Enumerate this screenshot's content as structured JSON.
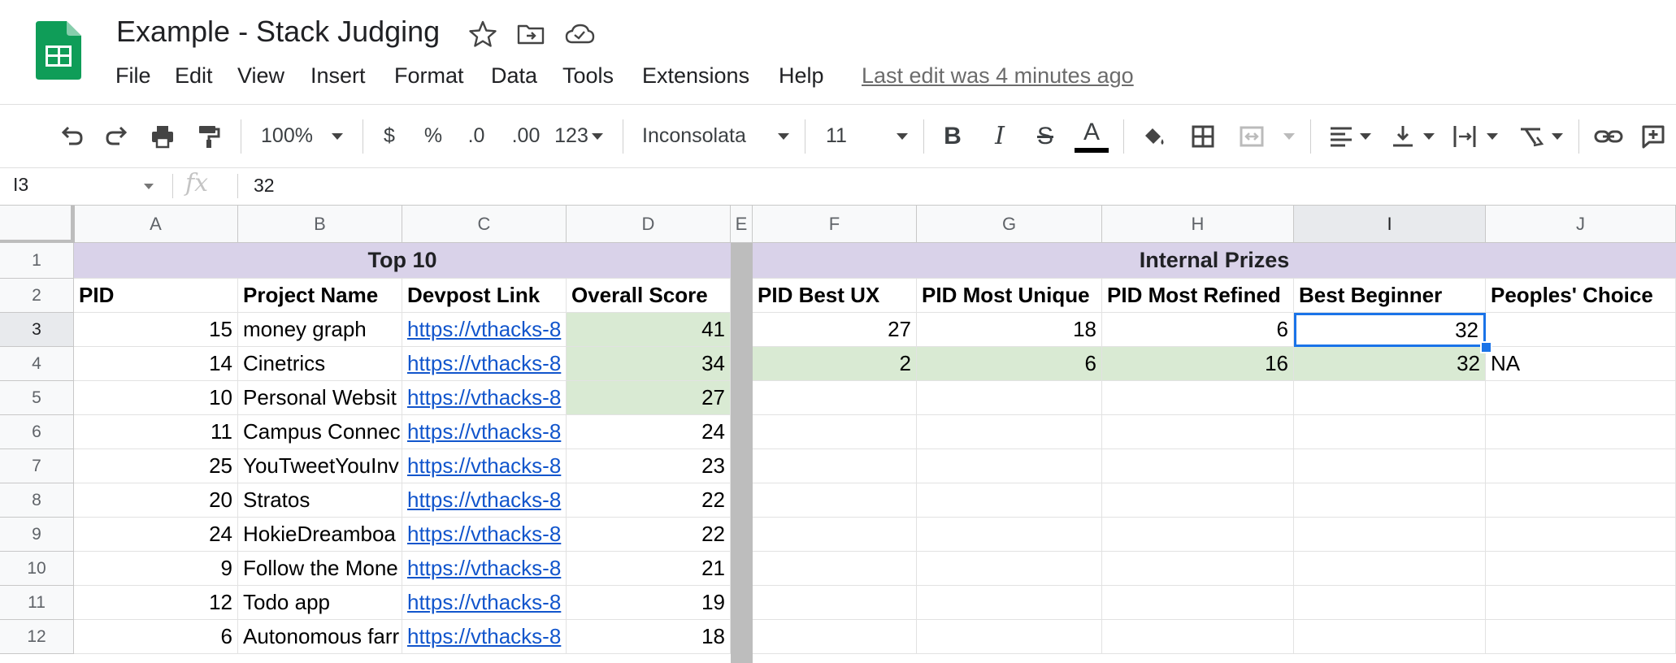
{
  "app": {
    "doc_title": "Example - Stack Judging",
    "last_edit": "Last edit was 4 minutes ago",
    "menu": [
      "File",
      "Edit",
      "View",
      "Insert",
      "Format",
      "Data",
      "Tools",
      "Extensions",
      "Help"
    ],
    "icons": [
      "star-icon",
      "move-to-folder-icon",
      "cloud-status-icon"
    ]
  },
  "toolbar": {
    "zoom": "100%",
    "currency": "$",
    "percent": "%",
    "decrease_decimal": ".0",
    "increase_decimal": ".00",
    "more_formats": "123",
    "font": "Inconsolata",
    "font_size": "11",
    "bold": "B",
    "italic": "I",
    "strikethrough": "S",
    "text_color": "A"
  },
  "formula_bar": {
    "name_box": "I3",
    "fx": "fx",
    "value": "32"
  },
  "columns": [
    "A",
    "B",
    "C",
    "D",
    "E",
    "F",
    "G",
    "H",
    "I",
    "J"
  ],
  "rows": [
    "1",
    "2",
    "3",
    "4",
    "5",
    "6",
    "7",
    "8",
    "9",
    "10",
    "11",
    "12"
  ],
  "section_titles": {
    "top10": "Top 10",
    "internal": "Internal Prizes"
  },
  "headers": {
    "left": [
      "PID",
      "Project Name",
      "Devpost Link",
      "Overall Score"
    ],
    "right": [
      "PID Best UX",
      "PID Most Unique",
      "PID Most Refined",
      "Best Beginner",
      "Peoples' Choice"
    ]
  },
  "top10_rows": [
    {
      "pid": "15",
      "name": "money graph",
      "link": "https://vthacks-8",
      "score": "41"
    },
    {
      "pid": "14",
      "name": "Cinetrics",
      "link": "https://vthacks-8",
      "score": "34"
    },
    {
      "pid": "10",
      "name": "Personal Websit",
      "link": "https://vthacks-8",
      "score": "27"
    },
    {
      "pid": "11",
      "name": "Campus Connec",
      "link": "https://vthacks-8",
      "score": "24"
    },
    {
      "pid": "25",
      "name": "YouTweetYouInv",
      "link": "https://vthacks-8",
      "score": "23"
    },
    {
      "pid": "20",
      "name": "Stratos",
      "link": "https://vthacks-8",
      "score": "22"
    },
    {
      "pid": "24",
      "name": "HokieDreamboa",
      "link": "https://vthacks-8",
      "score": "22"
    },
    {
      "pid": "9",
      "name": "Follow the Mone",
      "link": "https://vthacks-8",
      "score": "21"
    },
    {
      "pid": "12",
      "name": "Todo app",
      "link": "https://vthacks-8",
      "score": "19"
    },
    {
      "pid": "6",
      "name": "Autonomous farr",
      "link": "https://vthacks-8",
      "score": "18"
    }
  ],
  "prize_rows": [
    {
      "ux": "27",
      "unique": "18",
      "refined": "6",
      "beginner": "32",
      "choice": ""
    },
    {
      "ux": "2",
      "unique": "6",
      "refined": "16",
      "beginner": "32",
      "choice": "NA"
    }
  ],
  "colors": {
    "header_purple": "#d9d2e9",
    "highlight_green": "#d9ead3",
    "selection_blue": "#1a73e8",
    "link_blue": "#1155cc",
    "sheets_green": "#0f9d58"
  }
}
